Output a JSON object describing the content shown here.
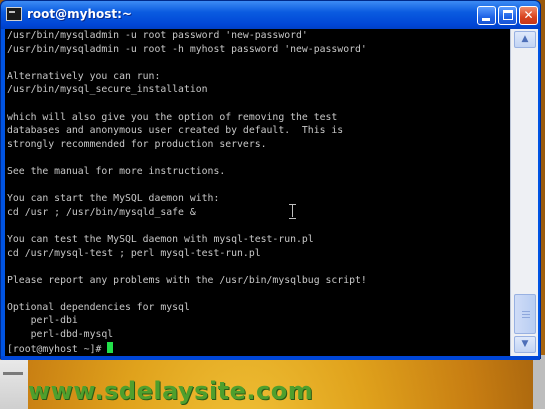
{
  "window": {
    "title": "root@myhost:~",
    "buttons": {
      "minimize": "minimize",
      "maximize": "maximize",
      "close": "✕"
    }
  },
  "terminal": {
    "lines": [
      "/usr/bin/mysqladmin -u root password 'new-password'",
      "/usr/bin/mysqladmin -u root -h myhost password 'new-password'",
      "",
      "Alternatively you can run:",
      "/usr/bin/mysql_secure_installation",
      "",
      "which will also give you the option of removing the test",
      "databases and anonymous user created by default.  This is",
      "strongly recommended for production servers.",
      "",
      "See the manual for more instructions.",
      "",
      "You can start the MySQL daemon with:",
      "cd /usr ; /usr/bin/mysqld_safe &",
      "",
      "You can test the MySQL daemon with mysql-test-run.pl",
      "cd /usr/mysql-test ; perl mysql-test-run.pl",
      "",
      "Please report any problems with the /usr/bin/mysqlbug script!",
      "",
      "Optional dependencies for mysql",
      "    perl-dbi",
      "    perl-dbd-mysql"
    ],
    "prompt": "[root@myhost ~]# "
  },
  "watermark": "www.sdelaysite.com",
  "colors": {
    "terminal_bg": "#000000",
    "terminal_fg": "#c8c8c8",
    "cursor": "#22e04a",
    "titlebar": "#0054e3",
    "watermark": "#4f9f2d"
  },
  "icons": [
    "terminal-icon",
    "minimize-icon",
    "maximize-icon",
    "close-icon",
    "scroll-up-icon",
    "scroll-down-icon"
  ]
}
